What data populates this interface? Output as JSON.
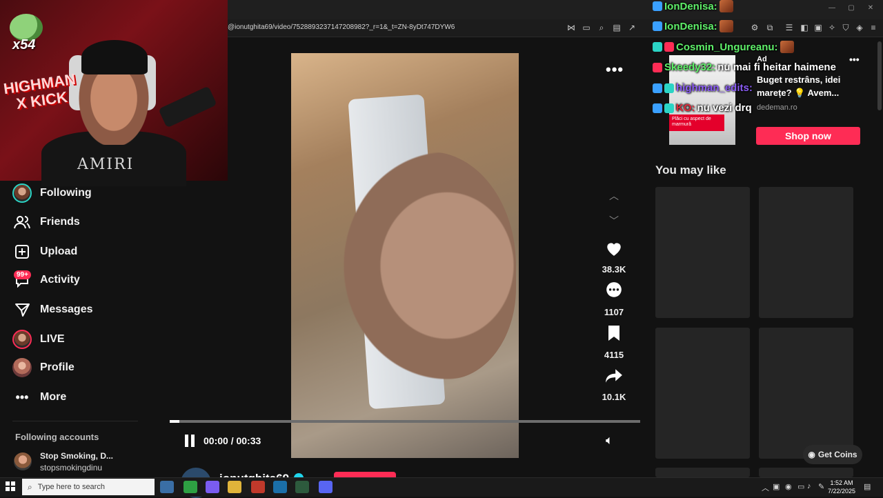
{
  "browser": {
    "url": "@ionutghita69/video/7528893237147208982?_r=1&_t=ZN-8yDt747DYW6"
  },
  "webcam": {
    "logo_text": "HIGHMAN X KICK",
    "shirt_text": "AMIRI",
    "counter": "x54"
  },
  "sidebar": {
    "items": [
      {
        "label": "Following",
        "icon": "following-avatar-icon"
      },
      {
        "label": "Friends",
        "icon": "friends-icon"
      },
      {
        "label": "Upload",
        "icon": "upload-icon"
      },
      {
        "label": "Activity",
        "icon": "activity-icon"
      },
      {
        "label": "Messages",
        "icon": "messages-icon"
      },
      {
        "label": "LIVE",
        "icon": "live-avatar-icon"
      },
      {
        "label": "Profile",
        "icon": "profile-avatar-icon"
      },
      {
        "label": "More",
        "icon": "more-icon"
      }
    ],
    "activity_badge": "99+",
    "following_accounts_title": "Following accounts",
    "accounts": [
      {
        "name": "Stop Smoking, D...",
        "handle": "stopsmokingdinu"
      }
    ]
  },
  "video": {
    "time": "00:00 / 00:33",
    "progress": 0.02,
    "actions": {
      "likes": "38.3K",
      "comments": "1107",
      "saves": "4115",
      "shares": "10.1K"
    },
    "creator": "ionutghita69"
  },
  "ad": {
    "label": "Ad",
    "text": "Buget restrâns, idei marețe? 💡 Avem...",
    "domain": "dedeman.ro",
    "image_tag": "Plăci cu aspect de marmură",
    "cta": "Shop now"
  },
  "right": {
    "you_may_like": "You may like",
    "get_coins": "Get Coins"
  },
  "chat": [
    {
      "user": "IonDenisa:",
      "message": "",
      "color": "#5ff06a"
    },
    {
      "user": "IonDenisa:",
      "message": "",
      "color": "#5ff06a"
    },
    {
      "user": "Cosmin_Ungureanu:",
      "message": "",
      "color": "#5ff06a"
    },
    {
      "user": "Skeedy32:",
      "message": "nu mai fi heitar haimene",
      "color": "#5ff06a"
    },
    {
      "user": "highman_edits:",
      "message": "",
      "color": "#8b5cf6"
    },
    {
      "user": "KO:",
      "message": "nu vezi drq",
      "color": "#e2293a"
    }
  ],
  "taskbar": {
    "search_placeholder": "Type here to search",
    "time": "1:52 AM",
    "date": "7/22/2025"
  },
  "colors": {
    "accent": "#fe2c55",
    "verified": "#20d5ec",
    "background": "#121212"
  }
}
